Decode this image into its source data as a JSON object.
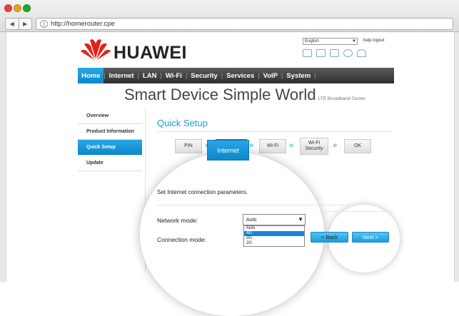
{
  "browser": {
    "url": "http://homerouter.cpe",
    "back_icon": "◀",
    "forward_icon": "▶"
  },
  "header": {
    "brand": "HUAWEI",
    "language": "English",
    "help_link": "help",
    "logout_link": "logout",
    "status_icons": [
      "sms-icon",
      "sim-icon",
      "signal-icon",
      "globe-icon",
      "wifi-icon"
    ]
  },
  "nav": {
    "items": [
      "Home",
      "Internet",
      "LAN",
      "Wi-Fi",
      "Security",
      "Services",
      "VoIP",
      "System"
    ],
    "active": "Home"
  },
  "banner": {
    "title": "Smart Device Simple World",
    "subtitle": "LTE Broadband Center"
  },
  "sidebar": {
    "items": [
      "Overview",
      "Product Information",
      "Quick Setup",
      "Update"
    ],
    "active": "Quick Setup"
  },
  "main": {
    "title": "Quick Setup",
    "steps": [
      "PIN",
      "Internet",
      "Wi-Fi",
      "Wi-Fi Security",
      "OK"
    ],
    "step_wifi_security_line1": "Wi-Fi",
    "step_wifi_security_line2": "Security",
    "active_step": "Internet",
    "instruction": "Set Internet connection parameters.",
    "network_mode_label": "Network mode:",
    "network_mode_value": "Auto",
    "network_mode_options": [
      "Auto",
      "4G",
      "3G",
      "2G"
    ],
    "network_mode_highlighted": "4G",
    "connection_mode_label": "Connection mode:",
    "back_button": "< Back",
    "next_button": "Next >"
  },
  "colors": {
    "accent": "#1a9fdf",
    "nav_bg": "#3a3a3a",
    "logo_red": "#e2231a"
  }
}
